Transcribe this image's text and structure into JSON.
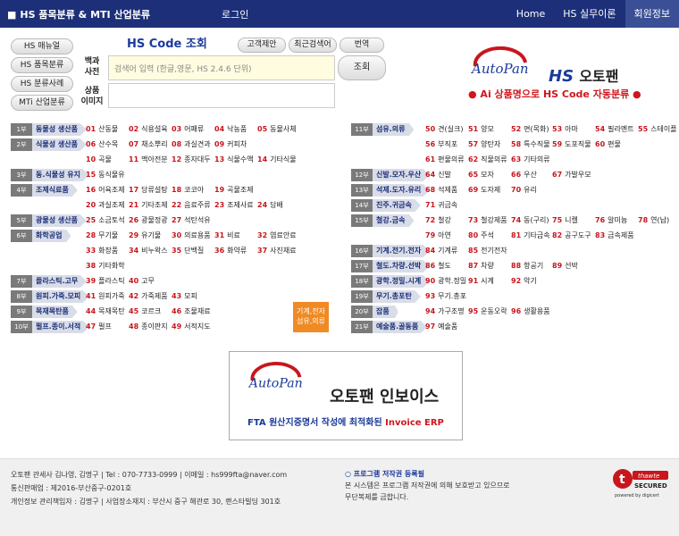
{
  "topbar": {
    "brand": "HS 품목분류 & MTI 산업분류",
    "login": "로그인",
    "nav": [
      "Home",
      "HS 실무이론",
      "회원정보"
    ]
  },
  "side_menu": [
    "HS 매뉴얼",
    "HS 품목분류",
    "HS 분류사례",
    "MTi 산업분류"
  ],
  "search": {
    "title": "HS Code 조회",
    "top_buttons": [
      "고객제안",
      "최근검색어",
      "번역"
    ],
    "dict_label": "백과\n사전",
    "placeholder": "검색어 입력 (한글,영문, HS 2.4.6 단위)",
    "search_button": "조회",
    "image_label": "상품\n이미지"
  },
  "brand": {
    "logo_text": "AutoPan",
    "hs": "HS",
    "ko": "오토팬",
    "ai_line": "● Ai 상품명으로 HS Code 자동분류 ●"
  },
  "sections_left": [
    {
      "tag": "1부",
      "name": "동물성 생산품",
      "rows": [
        [
          [
            "01",
            "산동물"
          ],
          [
            "02",
            "식용설육"
          ],
          [
            "03",
            "어패류"
          ],
          [
            "04",
            "낙농품"
          ],
          [
            "05",
            "동물사체"
          ]
        ]
      ]
    },
    {
      "tag": "2부",
      "name": "식물성 생산품",
      "rows": [
        [
          [
            "06",
            "산수목"
          ],
          [
            "07",
            "채소뿌리"
          ],
          [
            "08",
            "과실견과"
          ],
          [
            "09",
            "커피차"
          ]
        ],
        [
          [
            "10",
            "곡물"
          ],
          [
            "11",
            "맥아전분"
          ],
          [
            "12",
            "종자대두"
          ],
          [
            "13",
            "식물수액"
          ],
          [
            "14",
            "기타식물"
          ]
        ]
      ]
    },
    {
      "tag": "3부",
      "name": "동.식물성 유지",
      "rows": [
        [
          [
            "15",
            "동식물유"
          ]
        ]
      ]
    },
    {
      "tag": "4부",
      "name": "조제식료품",
      "rows": [
        [
          [
            "16",
            "어육조제"
          ],
          [
            "17",
            "당류설탕"
          ],
          [
            "18",
            "코코아"
          ],
          [
            "19",
            "곡물조제"
          ]
        ],
        [
          [
            "20",
            "과실조제"
          ],
          [
            "21",
            "기타조제"
          ],
          [
            "22",
            "음료주류"
          ],
          [
            "23",
            "조제사료"
          ],
          [
            "24",
            "담배"
          ]
        ]
      ]
    },
    {
      "tag": "5부",
      "name": "광물성 생산품",
      "rows": [
        [
          [
            "25",
            "소금토석"
          ],
          [
            "26",
            "광물정광"
          ],
          [
            "27",
            "석탄석유"
          ]
        ]
      ]
    },
    {
      "tag": "6부",
      "name": "화학공업",
      "rows": [
        [
          [
            "28",
            "무기물"
          ],
          [
            "29",
            "유기물"
          ],
          [
            "30",
            "의료용품"
          ],
          [
            "31",
            "비료"
          ],
          [
            "32",
            "염료안료"
          ]
        ],
        [
          [
            "33",
            "화장품"
          ],
          [
            "34",
            "비누왁스"
          ],
          [
            "35",
            "단백질"
          ],
          [
            "36",
            "화약류"
          ],
          [
            "37",
            "사진재료"
          ]
        ],
        [
          [
            "38",
            "기타화학"
          ]
        ]
      ]
    },
    {
      "tag": "7부",
      "name": "플라스틱.고무",
      "rows": [
        [
          [
            "39",
            "플라스틱"
          ],
          [
            "40",
            "고무"
          ]
        ]
      ]
    },
    {
      "tag": "8부",
      "name": "원피.가죽.모피",
      "rows": [
        [
          [
            "41",
            "원피가죽"
          ],
          [
            "42",
            "가죽제품"
          ],
          [
            "43",
            "모피"
          ]
        ]
      ]
    },
    {
      "tag": "9부",
      "name": "목재목탄품",
      "rows": [
        [
          [
            "44",
            "목재목탄"
          ],
          [
            "45",
            "코르크"
          ],
          [
            "46",
            "조물재료"
          ]
        ]
      ]
    },
    {
      "tag": "10부",
      "name": "펄프.종이.서적",
      "rows": [
        [
          [
            "47",
            "펄프"
          ],
          [
            "48",
            "종이판지"
          ],
          [
            "49",
            "서적지도"
          ]
        ]
      ]
    }
  ],
  "sections_right": [
    {
      "tag": "11부",
      "name": "섬유.의류",
      "rows": [
        [
          [
            "50",
            "견(실크)"
          ],
          [
            "51",
            "양모"
          ],
          [
            "52",
            "면(목화)"
          ],
          [
            "53",
            "아마"
          ],
          [
            "54",
            "필라멘트"
          ],
          [
            "55",
            "스테이플"
          ]
        ],
        [
          [
            "56",
            "부직포"
          ],
          [
            "57",
            "양탄자"
          ],
          [
            "58",
            "특수직물"
          ],
          [
            "59",
            "도포직물"
          ],
          [
            "60",
            "편물"
          ]
        ],
        [
          [
            "61",
            "편물의류"
          ],
          [
            "62",
            "직물의류"
          ],
          [
            "63",
            "기타의류"
          ]
        ]
      ]
    },
    {
      "tag": "12부",
      "name": "신발.모자.우산",
      "rows": [
        [
          [
            "64",
            "신발"
          ],
          [
            "65",
            "모자"
          ],
          [
            "66",
            "우산"
          ],
          [
            "67",
            "가발우모"
          ]
        ]
      ]
    },
    {
      "tag": "13부",
      "name": "석제.도자.유리",
      "rows": [
        [
          [
            "68",
            "석제품"
          ],
          [
            "69",
            "도자제"
          ],
          [
            "70",
            "유리"
          ]
        ]
      ]
    },
    {
      "tag": "14부",
      "name": "진주.귀금속",
      "rows": [
        [
          [
            "71",
            "귀금속"
          ]
        ]
      ]
    },
    {
      "tag": "15부",
      "name": "철강.금속",
      "rows": [
        [
          [
            "72",
            "철강"
          ],
          [
            "73",
            "철강제품"
          ],
          [
            "74",
            "동(구리)"
          ],
          [
            "75",
            "니켈"
          ],
          [
            "76",
            "알미늄"
          ],
          [
            "78",
            "연(납)"
          ]
        ],
        [
          [
            "79",
            "아연"
          ],
          [
            "80",
            "주석"
          ],
          [
            "81",
            "기타금속"
          ],
          [
            "82",
            "공구도구"
          ],
          [
            "83",
            "금속제품"
          ]
        ]
      ]
    },
    {
      "tag": "16부",
      "name": "기계.전기.전자",
      "rows": [
        [
          [
            "84",
            "기계류"
          ],
          [
            "85",
            "전기전자"
          ]
        ]
      ]
    },
    {
      "tag": "17부",
      "name": "철도.차량.선박",
      "rows": [
        [
          [
            "86",
            "철도"
          ],
          [
            "87",
            "차량"
          ],
          [
            "88",
            "항공기"
          ],
          [
            "89",
            "선박"
          ]
        ]
      ]
    },
    {
      "tag": "18부",
      "name": "광학.정밀.시계",
      "rows": [
        [
          [
            "90",
            "광학.정밀"
          ],
          [
            "91",
            "시계"
          ],
          [
            "92",
            "악기"
          ]
        ]
      ]
    },
    {
      "tag": "19부",
      "name": "무기.총포탄",
      "rows": [
        [
          [
            "93",
            "무기.총포"
          ]
        ]
      ]
    },
    {
      "tag": "20부",
      "name": "잡품",
      "rows": [
        [
          [
            "94",
            "가구조명"
          ],
          [
            "95",
            "운동오락"
          ],
          [
            "96",
            "생활용품"
          ]
        ]
      ]
    },
    {
      "tag": "21부",
      "name": "예술품.골동품",
      "rows": [
        [
          [
            "97",
            "예술품"
          ]
        ]
      ]
    }
  ],
  "mid_orange": [
    "기계,전자",
    "섬유,의류"
  ],
  "banner": {
    "logo_text": "AutoPan",
    "title": "오토팬 인보이스",
    "sub_prefix": "FTA 원산지증명서 작성에 최적화된 ",
    "sub_highlight": "Invoice ERP"
  },
  "footer": {
    "line1": "오토팬 관세사 김나영, 김명구 | Tel : 070-7733-0999 | 이메일 : hs999fta@naver.com",
    "line2": "통신판매업 : 제2016-부산중구-0201호",
    "line3": "개인정보 관리책임자 : 김명구 | 사업장소재지 : 부산시 중구 해관로 30, 랜스타빌딩 301호",
    "copyright_head": "○ 프로그램 저작권 등록필",
    "copyright_1": "본 시스템은 프로그램 저작권에 의해 보호받고 있으므로",
    "copyright_2": "무단복제를 금합니다.",
    "seal_top": "thawte",
    "seal_mid": "SECURED",
    "seal_bottom": "powered by digicert"
  },
  "colors": {
    "nav": "#1c2f78",
    "accent_red": "#c8161d",
    "orange": "#f08a24"
  }
}
